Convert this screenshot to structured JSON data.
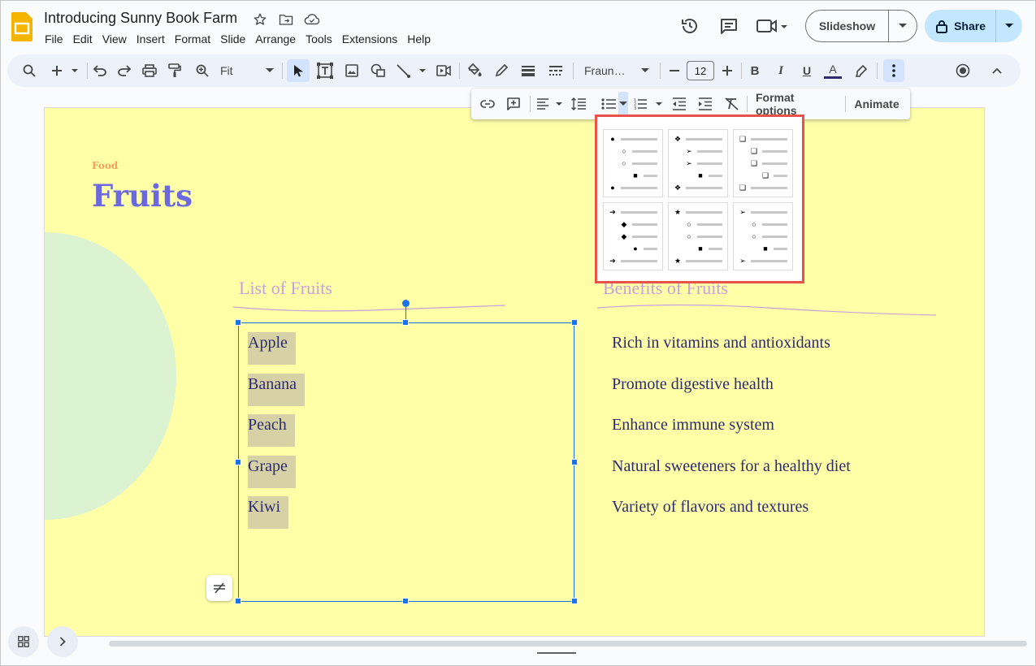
{
  "app": {
    "logo_icon": "google-slides-logo",
    "brand_color": "#f4b400",
    "title": "Introducing Sunny Book Farm"
  },
  "menu": [
    "File",
    "Edit",
    "View",
    "Insert",
    "Format",
    "Slide",
    "Arrange",
    "Tools",
    "Extensions",
    "Help"
  ],
  "header": {
    "slideshow_label": "Slideshow",
    "share_label": "Share",
    "share_color": "#c2e7ff"
  },
  "toolbar": {
    "zoom_label": "Fit",
    "font_name": "Fraun…",
    "font_size": "12"
  },
  "format_bar": {
    "format_options_label": "Format options",
    "animate_label": "Animate"
  },
  "slide": {
    "background": "#ffffa8",
    "kicker": "Food",
    "title": "Fruits",
    "left_heading": "List of Fruits",
    "right_heading": "Benefits of Fruits",
    "fruits": [
      "Apple",
      "Banana",
      "Peach",
      "Grape",
      "Kiwi"
    ],
    "benefits": [
      "Rich in vitamins and antioxidants",
      "Promote digestive health",
      "Enhance immune system",
      "Natural sweeteners for a healthy diet",
      "Variety of flavors and textures"
    ]
  },
  "bullet_styles": [
    {
      "name": "disc-circle-square",
      "glyphs": [
        "●",
        "○",
        "○",
        "■",
        "●"
      ]
    },
    {
      "name": "diamond-x-arrow",
      "glyphs": [
        "❖",
        "➢",
        "➢",
        "■",
        "❖"
      ]
    },
    {
      "name": "3d-square",
      "glyphs": [
        "❑",
        "❑",
        "❑",
        "❑",
        "❑"
      ]
    },
    {
      "name": "arrow-diamond",
      "glyphs": [
        "➔",
        "◆",
        "◆",
        "●",
        "➔"
      ]
    },
    {
      "name": "star-circle-square",
      "glyphs": [
        "★",
        "○",
        "○",
        "■",
        "★"
      ]
    },
    {
      "name": "arrowhead-circle-square",
      "glyphs": [
        "➢",
        "○",
        "○",
        "■",
        "➢"
      ]
    }
  ]
}
